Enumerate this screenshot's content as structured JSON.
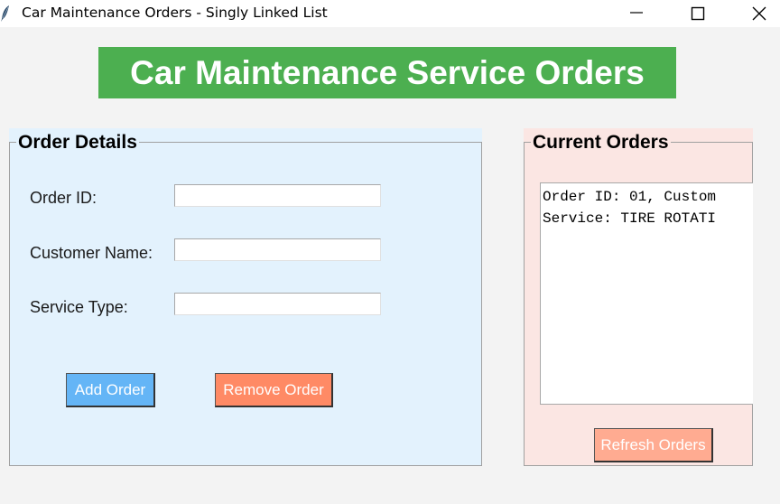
{
  "window": {
    "title": "Car Maintenance Orders - Singly Linked List",
    "icon": "feather-icon",
    "controls": [
      "minimize-icon",
      "maximize-icon",
      "close-icon"
    ]
  },
  "banner": {
    "text": "Car Maintenance Service Orders",
    "background": "#4caf50",
    "color": "#ffffff"
  },
  "order_details": {
    "legend": "Order Details",
    "background": "#e3f2fd",
    "fields": {
      "order_id": {
        "label": "Order ID:",
        "value": ""
      },
      "customer_name": {
        "label": "Customer Name:",
        "value": ""
      },
      "service_type": {
        "label": "Service Type:",
        "value": ""
      }
    },
    "add_button": {
      "label": "Add Order",
      "color": "#64b5f6"
    },
    "remove_button": {
      "label": "Remove Order",
      "color": "#ff8a65"
    }
  },
  "current_orders": {
    "legend": "Current Orders",
    "background": "#fbe6e3",
    "lines": [
      "Order ID: 01, Custom",
      "Service: TIRE ROTATI"
    ],
    "refresh_button": {
      "label": "Refresh Orders",
      "color": "#ffab91"
    }
  }
}
